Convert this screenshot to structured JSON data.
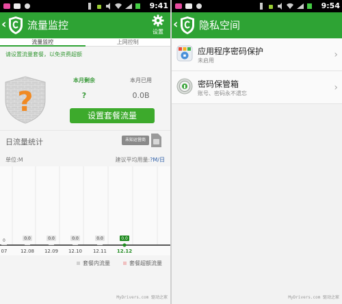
{
  "left": {
    "status_time": "9:41",
    "title": "流量监控",
    "settings_label": "设置",
    "tabs": [
      "流量监控",
      "上网控制"
    ],
    "hint": "请设置流量套餐，以免资费超额",
    "shield_symbol": "?",
    "remaining_label": "本月剩余",
    "remaining_value": "?",
    "used_label": "本月已用",
    "used_value": "0.0B",
    "set_plan_button": "设置套餐流量",
    "daily_title": "日流量统计",
    "carrier_badge": "未知运营商",
    "unit_label": "单位:M",
    "avg_prefix": "建议平均用量:",
    "avg_value": "?M/日",
    "chart_data": {
      "type": "bar",
      "categories": [
        "07",
        "12.08",
        "12.09",
        "12.10",
        "12.11",
        "12.12"
      ],
      "values": [
        0.0,
        0.0,
        0.0,
        0.0,
        0.0,
        0.0
      ],
      "series": [
        {
          "name": "套餐内流量"
        },
        {
          "name": "套餐超额流量"
        }
      ],
      "selected": "12.12",
      "y_origin_label": "0"
    },
    "legend_in": "套餐内流量",
    "legend_over": "套餐超额流量",
    "watermark": "MyDrivers.com 驱动之家"
  },
  "right": {
    "status_time": "9:54",
    "title": "隐私空间",
    "items": [
      {
        "title": "应用程序密码保护",
        "subtitle": "未启用"
      },
      {
        "title": "密码保管箱",
        "subtitle": "账号、密码永不遗忘"
      }
    ],
    "watermark": "MyDrivers.com 驱动之家"
  },
  "colors": {
    "brand_green": "#2ea334",
    "button_green": "#3daa2c",
    "selected_bar": "#1f8a1f",
    "shield_gray": "#c9c9c9",
    "question_orange": "#f08a24"
  },
  "icons": [
    "back-chevron-icon",
    "app-shield-logo-icon",
    "gear-icon",
    "sim-card-icon",
    "app-lock-icon",
    "password-vault-icon",
    "chevron-right-icon"
  ]
}
